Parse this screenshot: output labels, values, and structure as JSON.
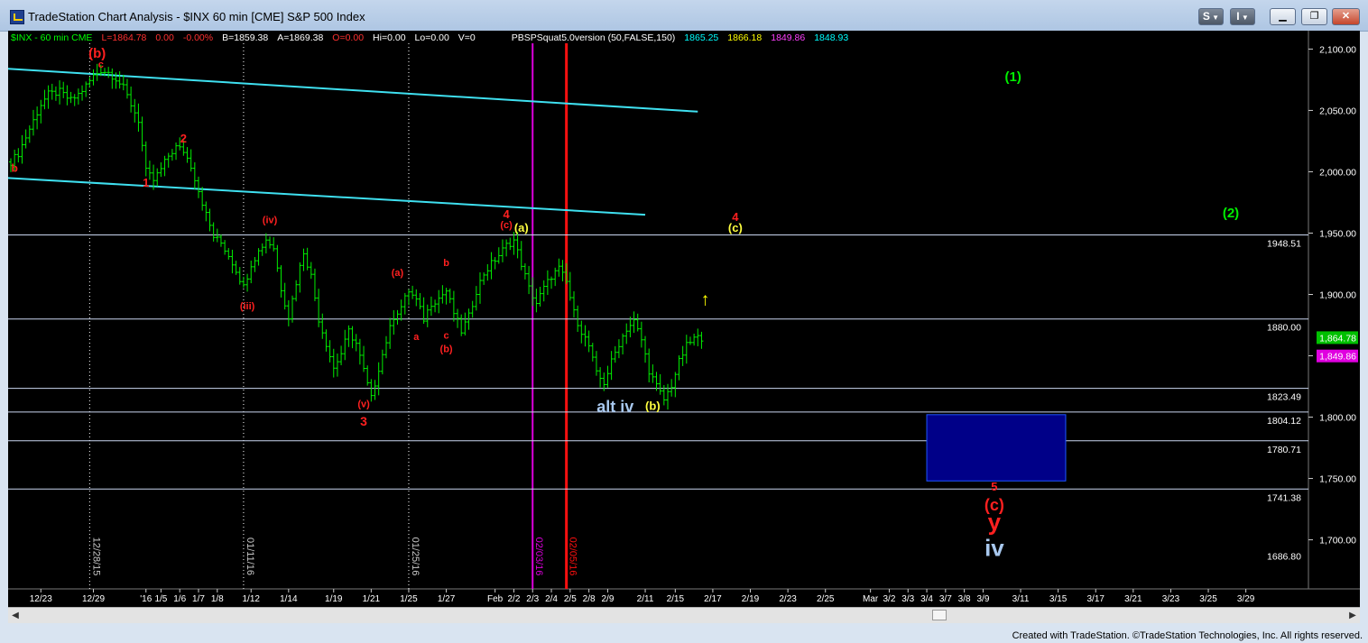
{
  "window": {
    "title": "TradeStation Chart Analysis - $INX 60 min [CME] S&P 500 Index",
    "buttons": {
      "s_label": "S",
      "i_label": "I"
    }
  },
  "header": {
    "items": [
      {
        "text": "$INX - 60 min  CME",
        "color": "#00ff00"
      },
      {
        "text": "L=1864.78",
        "color": "#ff3030"
      },
      {
        "text": "0.00",
        "color": "#ff3030"
      },
      {
        "text": "-0.00%",
        "color": "#ff3030"
      },
      {
        "text": "B=1859.38",
        "color": "#ffffff"
      },
      {
        "text": "A=1869.38",
        "color": "#ffffff"
      },
      {
        "text": "O=0.00",
        "color": "#ff3030"
      },
      {
        "text": "Hi=0.00",
        "color": "#ffffff"
      },
      {
        "text": "Lo=0.00",
        "color": "#ffffff"
      },
      {
        "text": "V=0",
        "color": "#ffffff"
      },
      {
        "text": "PBSPSquat5.0version (50,FALSE,150)",
        "color": "#ffffff"
      },
      {
        "text": "1865.25",
        "color": "#00ffff"
      },
      {
        "text": "1866.18",
        "color": "#ffff00"
      },
      {
        "text": "1849.86",
        "color": "#ff40ff"
      },
      {
        "text": "1848.93",
        "color": "#00ffff"
      }
    ]
  },
  "chart_data": {
    "type": "line",
    "title": "$INX 60 min [CME] S&P 500 Index",
    "ylim": [
      1660,
      2115
    ],
    "y_ticks": [
      1700,
      1750,
      1800,
      1850,
      1900,
      1950,
      2000,
      2050,
      2100
    ],
    "y_tick_labels": [
      "1,700.00",
      "1,750.00",
      "1,800.00",
      "1,850.00",
      "1,900.00",
      "1,950.00",
      "2,000.00",
      "2,050.00",
      "2,100.00"
    ],
    "x_tick_labels": [
      "12/23",
      "12/29",
      "'16",
      "1/5",
      "1/6",
      "1/7",
      "1/8",
      "1/12",
      "1/14",
      "1/19",
      "1/21",
      "1/25",
      "1/27",
      "Feb",
      "2/2",
      "2/3",
      "2/4",
      "2/5",
      "2/8",
      "2/9",
      "2/11",
      "2/15",
      "2/17",
      "2/19",
      "2/23",
      "2/25",
      "Mar",
      "3/2",
      "3/3",
      "3/4",
      "3/7",
      "3/8",
      "3/9",
      "3/11",
      "3/15",
      "3/17",
      "3/21",
      "3/23",
      "3/25",
      "3/29"
    ],
    "x_tick_index": [
      8,
      22,
      36,
      40,
      45,
      50,
      55,
      64,
      74,
      86,
      96,
      106,
      116,
      129,
      134,
      139,
      144,
      149,
      154,
      159,
      169,
      177,
      187,
      197,
      207,
      217,
      229,
      234,
      239,
      244,
      249,
      254,
      259,
      269,
      279,
      289,
      299,
      309,
      319,
      329
    ],
    "x_count": 340,
    "last_price": 1864.78,
    "last_price_label": "1,864.78",
    "indicator_marker_value": 1849.86,
    "indicator_marker_label": "1,849.86",
    "series": [
      {
        "type": "ohlc",
        "color": "#00ee00",
        "points": [
          [
            0,
            2008
          ],
          [
            2,
            2015
          ],
          [
            5,
            2035
          ],
          [
            8,
            2055
          ],
          [
            10,
            2063
          ],
          [
            13,
            2065
          ],
          [
            16,
            2058
          ],
          [
            18,
            2063
          ],
          [
            20,
            2070
          ],
          [
            22,
            2078
          ],
          [
            24,
            2083
          ],
          [
            26,
            2081
          ],
          [
            28,
            2076
          ],
          [
            30,
            2068
          ],
          [
            32,
            2055
          ],
          [
            34,
            2042
          ],
          [
            36,
            2000
          ],
          [
            38,
            1993
          ],
          [
            40,
            2002
          ],
          [
            42,
            2013
          ],
          [
            44,
            2020
          ],
          [
            46,
            2017
          ],
          [
            48,
            2005
          ],
          [
            50,
            1985
          ],
          [
            52,
            1965
          ],
          [
            54,
            1947
          ],
          [
            56,
            1942
          ],
          [
            58,
            1932
          ],
          [
            60,
            1920
          ],
          [
            62,
            1906
          ],
          [
            64,
            1925
          ],
          [
            66,
            1935
          ],
          [
            68,
            1945
          ],
          [
            70,
            1938
          ],
          [
            72,
            1905
          ],
          [
            74,
            1882
          ],
          [
            76,
            1910
          ],
          [
            78,
            1935
          ],
          [
            80,
            1915
          ],
          [
            82,
            1880
          ],
          [
            84,
            1860
          ],
          [
            86,
            1840
          ],
          [
            88,
            1852
          ],
          [
            90,
            1870
          ],
          [
            92,
            1860
          ],
          [
            94,
            1838
          ],
          [
            96,
            1815
          ],
          [
            98,
            1840
          ],
          [
            100,
            1862
          ],
          [
            102,
            1882
          ],
          [
            104,
            1890
          ],
          [
            106,
            1903
          ],
          [
            108,
            1895
          ],
          [
            110,
            1880
          ],
          [
            112,
            1893
          ],
          [
            114,
            1897
          ],
          [
            116,
            1903
          ],
          [
            118,
            1885
          ],
          [
            120,
            1870
          ],
          [
            122,
            1882
          ],
          [
            124,
            1903
          ],
          [
            126,
            1917
          ],
          [
            128,
            1925
          ],
          [
            130,
            1932
          ],
          [
            132,
            1940
          ],
          [
            134,
            1944
          ],
          [
            136,
            1925
          ],
          [
            138,
            1905
          ],
          [
            140,
            1893
          ],
          [
            142,
            1905
          ],
          [
            144,
            1915
          ],
          [
            146,
            1921
          ],
          [
            148,
            1910
          ],
          [
            150,
            1885
          ],
          [
            152,
            1870
          ],
          [
            154,
            1858
          ],
          [
            156,
            1835
          ],
          [
            158,
            1828
          ],
          [
            160,
            1845
          ],
          [
            162,
            1860
          ],
          [
            164,
            1872
          ],
          [
            166,
            1878
          ],
          [
            168,
            1863
          ],
          [
            170,
            1838
          ],
          [
            172,
            1825
          ],
          [
            174,
            1814
          ],
          [
            176,
            1826
          ],
          [
            178,
            1845
          ],
          [
            180,
            1858
          ],
          [
            182,
            1864
          ],
          [
            184,
            1865
          ]
        ]
      }
    ],
    "horizontal_lines": [
      {
        "value": 1948.51,
        "label": "1948.51"
      },
      {
        "value": 1880.0,
        "label": "1880.00"
      },
      {
        "value": 1823.49,
        "label": "1823.49"
      },
      {
        "value": 1804.12,
        "label": "1804.12"
      },
      {
        "value": 1780.71,
        "label": "1780.71"
      },
      {
        "value": 1741.38,
        "label": "1741.38"
      }
    ],
    "bottom_value_label": {
      "value": 1686.8,
      "label": "1686.80"
    },
    "trendlines": [
      {
        "from": [
          -1,
          2084
        ],
        "to": [
          183,
          2049
        ],
        "color": "#3fe0f0"
      },
      {
        "from": [
          -1,
          1995
        ],
        "to": [
          169,
          1965
        ],
        "color": "#3fe0f0"
      }
    ],
    "vertical_markers": [
      {
        "x": 21,
        "label": "12/28/15",
        "color": "#ffffff",
        "style": "dotted"
      },
      {
        "x": 62,
        "label": "01/11/16",
        "color": "#ffffff",
        "style": "dotted"
      },
      {
        "x": 106,
        "label": "01/25/16",
        "color": "#ffffff",
        "style": "dotted"
      },
      {
        "x": 139,
        "label": "02/03/16",
        "color": "#dd00dd",
        "style": "solid"
      },
      {
        "x": 148,
        "label": "02/05/16",
        "color": "#ff1010",
        "style": "solid"
      }
    ],
    "target_box": {
      "x_from": 244,
      "x_to": 281,
      "y_from": 1748,
      "y_to": 1802,
      "fill": "#000088",
      "edge": "#1f56ff"
    },
    "annotations": [
      {
        "text": "(b)",
        "x": 23,
        "y": 2093,
        "color": "#ff2020",
        "size": 15
      },
      {
        "text": "c",
        "x": 24,
        "y": 2085,
        "color": "#ff2020",
        "size": 11
      },
      {
        "text": "b",
        "x": 1,
        "y": 2000,
        "color": "#ff2020",
        "size": 12
      },
      {
        "text": "2",
        "x": 46,
        "y": 2024,
        "color": "#ff2020",
        "size": 13
      },
      {
        "text": "1",
        "x": 36,
        "y": 1988,
        "color": "#ff2020",
        "size": 13
      },
      {
        "text": "(iv)",
        "x": 69,
        "y": 1958,
        "color": "#ff2020",
        "size": 11
      },
      {
        "text": "(iii)",
        "x": 63,
        "y": 1888,
        "color": "#ff2020",
        "size": 11
      },
      {
        "text": "(v)",
        "x": 94,
        "y": 1808,
        "color": "#ff2020",
        "size": 11
      },
      {
        "text": "3",
        "x": 94,
        "y": 1793,
        "color": "#ff2020",
        "size": 14
      },
      {
        "text": "(a)",
        "x": 103,
        "y": 1915,
        "color": "#ff2020",
        "size": 11
      },
      {
        "text": "a",
        "x": 108,
        "y": 1863,
        "color": "#ff2020",
        "size": 11
      },
      {
        "text": "b",
        "x": 116,
        "y": 1923,
        "color": "#ff2020",
        "size": 11
      },
      {
        "text": "c",
        "x": 116,
        "y": 1864,
        "color": "#ff2020",
        "size": 11
      },
      {
        "text": "(b)",
        "x": 116,
        "y": 1853,
        "color": "#ff2020",
        "size": 11
      },
      {
        "text": "4",
        "x": 132,
        "y": 1962,
        "color": "#ff2020",
        "size": 13
      },
      {
        "text": "(c)",
        "x": 132,
        "y": 1954,
        "color": "#ff2020",
        "size": 11
      },
      {
        "text": "(a)",
        "x": 136,
        "y": 1951,
        "color": "#ffff40",
        "size": 13
      },
      {
        "text": "alt iv",
        "x": 161,
        "y": 1804,
        "color": "#a8c8ee",
        "size": 18
      },
      {
        "text": "(b)",
        "x": 171,
        "y": 1806,
        "color": "#ffff40",
        "size": 13
      },
      {
        "text": "4",
        "x": 193,
        "y": 1960,
        "color": "#ff2020",
        "size": 13
      },
      {
        "text": "(c)",
        "x": 193,
        "y": 1951,
        "color": "#ffff40",
        "size": 13
      },
      {
        "text": "↑",
        "x": 185,
        "y": 1891,
        "color": "#ffff00",
        "size": 20
      },
      {
        "text": "(1)",
        "x": 267,
        "y": 2074,
        "color": "#00ee00",
        "size": 15
      },
      {
        "text": "(2)",
        "x": 325,
        "y": 1963,
        "color": "#00ee00",
        "size": 15
      },
      {
        "text": "5",
        "x": 262,
        "y": 1740,
        "color": "#ff2020",
        "size": 13
      },
      {
        "text": "(c)",
        "x": 262,
        "y": 1724,
        "color": "#ff2020",
        "size": 18
      },
      {
        "text": "y",
        "x": 262,
        "y": 1708,
        "color": "#ff2020",
        "size": 26
      },
      {
        "text": "iv",
        "x": 262,
        "y": 1687,
        "color": "#a8c8ee",
        "size": 26
      }
    ]
  },
  "footer": {
    "text": "Created with TradeStation. ©TradeStation Technologies, Inc. All rights reserved."
  },
  "scrollbar": {
    "left_arrow": "◀",
    "right_arrow": "▶"
  }
}
